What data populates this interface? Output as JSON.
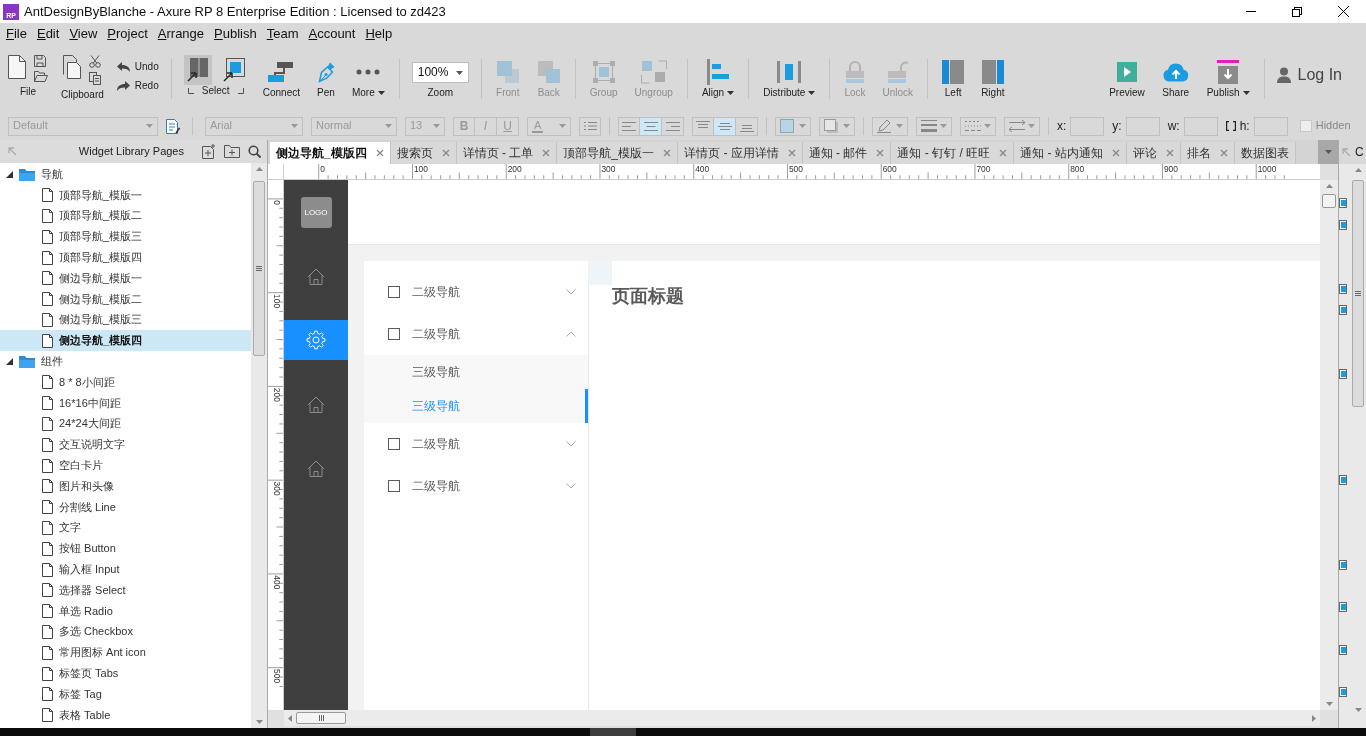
{
  "window": {
    "app_icon": "RP",
    "title": "AntDesignByBlanche - Axure RP 8 Enterprise Edition : Licensed to zd423"
  },
  "menu_bar": [
    "File",
    "Edit",
    "View",
    "Project",
    "Arrange",
    "Publish",
    "Team",
    "Account",
    "Help"
  ],
  "toolbar": {
    "main": [
      {
        "items": [
          {
            "kind": "file",
            "label": "File"
          },
          {
            "kind": "clipboard",
            "label": "Clipboard"
          },
          {
            "kind": "history",
            "items": [
              {
                "kind": "undo",
                "label": "Undo"
              },
              {
                "kind": "redo",
                "label": "Redo"
              }
            ]
          }
        ]
      },
      {
        "items": [
          {
            "kind": "select",
            "label": "Select",
            "modes": [
              {
                "kind": "filled",
                "selected": true
              },
              {
                "kind": "framed",
                "selected": false
              }
            ]
          },
          {
            "kind": "connect",
            "label": "Connect",
            "disabled": false,
            "dropdown": false
          },
          {
            "kind": "pen",
            "label": "Pen",
            "disabled": false,
            "dropdown": false
          },
          {
            "kind": "more",
            "label": "More",
            "disabled": false,
            "dropdown": true
          }
        ]
      },
      {
        "items": [
          {
            "kind": "zoom",
            "label": "Zoom",
            "value": "100%"
          }
        ]
      },
      {
        "items": [
          {
            "kind": "front",
            "label": "Front",
            "disabled": true,
            "dropdown": false
          },
          {
            "kind": "back",
            "label": "Back",
            "disabled": true,
            "dropdown": false
          }
        ]
      },
      {
        "items": [
          {
            "kind": "group",
            "label": "Group",
            "disabled": true,
            "dropdown": false
          },
          {
            "kind": "ungroup",
            "label": "Ungroup",
            "disabled": true,
            "dropdown": false
          }
        ]
      },
      {
        "items": [
          {
            "kind": "align",
            "label": "Align",
            "disabled": false,
            "dropdown": true
          }
        ]
      },
      {
        "items": [
          {
            "kind": "distribute",
            "label": "Distribute",
            "disabled": false,
            "dropdown": true
          }
        ]
      },
      {
        "items": [
          {
            "kind": "lock",
            "label": "Lock",
            "disabled": true,
            "dropdown": false
          },
          {
            "kind": "unlock",
            "label": "Unlock",
            "disabled": true,
            "dropdown": false
          }
        ]
      },
      {
        "items": [
          {
            "kind": "left",
            "label": "Left",
            "disabled": false,
            "dropdown": false
          },
          {
            "kind": "right",
            "label": "Right",
            "disabled": false,
            "dropdown": false
          }
        ]
      }
    ],
    "end": [
      {
        "items": [
          {
            "kind": "preview",
            "label": "Preview",
            "disabled": false,
            "dropdown": false
          },
          {
            "kind": "share",
            "label": "Share",
            "disabled": false,
            "dropdown": false
          },
          {
            "kind": "publish",
            "label": "Publish",
            "disabled": false,
            "dropdown": true
          }
        ]
      },
      {
        "items": [
          {
            "kind": "login",
            "label": "Log In"
          }
        ]
      }
    ]
  },
  "format_bar": {
    "disabled": true,
    "style": "Default",
    "font": "Arial",
    "font_style": "Normal",
    "font_size": "13",
    "text_styles": [
      {
        "kind": "bold",
        "label": "B"
      },
      {
        "kind": "italic",
        "label": "I"
      },
      {
        "kind": "underline",
        "label": "U"
      }
    ],
    "text_color": "A",
    "horizontal_align": [
      {
        "kind": "left",
        "selected": false
      },
      {
        "kind": "center",
        "selected": true
      },
      {
        "kind": "right",
        "selected": false
      }
    ],
    "vertical_align": [
      {
        "kind": "top",
        "selected": false
      },
      {
        "kind": "middle",
        "selected": true
      },
      {
        "kind": "bottom",
        "selected": false
      }
    ],
    "geometry": [
      {
        "label": "x:",
        "aspect_toggle": false
      },
      {
        "label": "y:",
        "aspect_toggle": false
      },
      {
        "label": "w:",
        "aspect_toggle": false
      },
      {
        "label": "h:",
        "aspect_toggle": true
      }
    ],
    "hidden": {
      "label": "Hidden",
      "checked": false
    }
  },
  "pages_panel": {
    "title": "Widget Library Pages",
    "tree": [
      {
        "label": "导航",
        "expanded": true,
        "selected": false,
        "children": [
          {
            "label": "顶部导航_模版一",
            "selected": false
          },
          {
            "label": "顶部导航_模版二",
            "selected": false
          },
          {
            "label": "顶部导航_模版三",
            "selected": false
          },
          {
            "label": "顶部导航_模版四",
            "selected": false
          },
          {
            "label": "侧边导航_模版一",
            "selected": false
          },
          {
            "label": "侧边导航_模版二",
            "selected": false
          },
          {
            "label": "侧边导航_模版三",
            "selected": false
          },
          {
            "label": "侧边导航_模版四",
            "selected": true
          }
        ]
      },
      {
        "label": "组件",
        "expanded": true,
        "selected": false,
        "children": [
          {
            "label": "8 * 8小间距",
            "selected": false
          },
          {
            "label": "16*16中间距",
            "selected": false
          },
          {
            "label": "24*24大间距",
            "selected": false
          },
          {
            "label": "交互说明文字",
            "selected": false
          },
          {
            "label": "空白卡片",
            "selected": false
          },
          {
            "label": "图片和头像",
            "selected": false
          },
          {
            "label": "分割线 Line",
            "selected": false
          },
          {
            "label": "文字",
            "selected": false
          },
          {
            "label": "按钮 Button",
            "selected": false
          },
          {
            "label": "输入框 Input",
            "selected": false
          },
          {
            "label": "选择器 Select",
            "selected": false
          },
          {
            "label": "单选 Radio",
            "selected": false
          },
          {
            "label": "多选 Checkbox",
            "selected": false
          },
          {
            "label": "常用图标 Ant icon",
            "selected": false
          },
          {
            "label": "标签页 Tabs",
            "selected": false
          },
          {
            "label": "标签 Tag",
            "selected": false
          },
          {
            "label": "表格 Table",
            "selected": false
          }
        ]
      }
    ]
  },
  "tabs": [
    {
      "label": "侧边导航_模版四",
      "selected": true,
      "closable": true
    },
    {
      "label": "搜索页",
      "selected": false,
      "closable": true
    },
    {
      "label": "详情页 - 工单",
      "selected": false,
      "closable": true
    },
    {
      "label": "顶部导航_模版一",
      "selected": false,
      "closable": true
    },
    {
      "label": "详情页 - 应用详情",
      "selected": false,
      "closable": true
    },
    {
      "label": "通知 - 邮件",
      "selected": false,
      "closable": true
    },
    {
      "label": "通知 - 钉钉 / 旺旺",
      "selected": false,
      "closable": true
    },
    {
      "label": "通知 - 站内通知",
      "selected": false,
      "closable": true
    },
    {
      "label": "评论",
      "selected": false,
      "closable": true
    },
    {
      "label": "排名",
      "selected": false,
      "closable": true
    },
    {
      "label": "数据图表",
      "selected": false,
      "closable": false
    }
  ],
  "rulers": {
    "horizontal": [
      "0",
      "100",
      "200",
      "300",
      "400",
      "500",
      "600",
      "700",
      "800",
      "900",
      "1000"
    ],
    "vertical": [
      "0",
      "100",
      "200",
      "300",
      "400",
      "500"
    ]
  },
  "canvas": {
    "logo": "LOGO",
    "rail": [
      {
        "kind": "home",
        "selected": false
      },
      {
        "kind": "gear",
        "selected": true
      },
      {
        "kind": "home",
        "selected": false
      },
      {
        "kind": "home",
        "selected": false
      }
    ],
    "menu": [
      {
        "label": "二级导航",
        "expanded": false
      },
      {
        "label": "二级导航",
        "expanded": true,
        "children": [
          {
            "label": "三级导航",
            "selected": false
          },
          {
            "label": "三级导航",
            "selected": true
          }
        ]
      },
      {
        "label": "二级导航",
        "expanded": false
      },
      {
        "label": "二级导航",
        "expanded": false
      }
    ],
    "page_title": "页面标题"
  },
  "right_panel": {
    "title": "C"
  }
}
